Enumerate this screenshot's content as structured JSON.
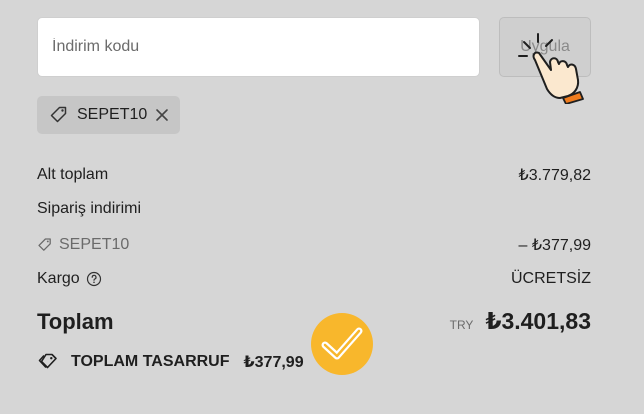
{
  "discount": {
    "placeholder": "İndirim kodu",
    "apply_label": "Uygula"
  },
  "applied_code": {
    "code": "SEPET10",
    "icon": "tag-icon",
    "remove_icon": "close-icon"
  },
  "summary": {
    "subtotal_label": "Alt toplam",
    "subtotal_value": "₺3.779,82",
    "order_discount_label": "Sipariş indirimi",
    "discount_code": "SEPET10",
    "discount_value": "– ₺377,99",
    "shipping_label": "Kargo",
    "shipping_value": "ÜCRETSİZ",
    "total_label": "Toplam",
    "currency": "TRY",
    "total_value": "₺3.401,83"
  },
  "savings": {
    "label": "TOPLAM TASARRUF",
    "value": "₺377,99"
  },
  "colors": {
    "background": "#d6d6d6",
    "badge": "#f8b72c",
    "cursor_cuff": "#f07c1e"
  }
}
